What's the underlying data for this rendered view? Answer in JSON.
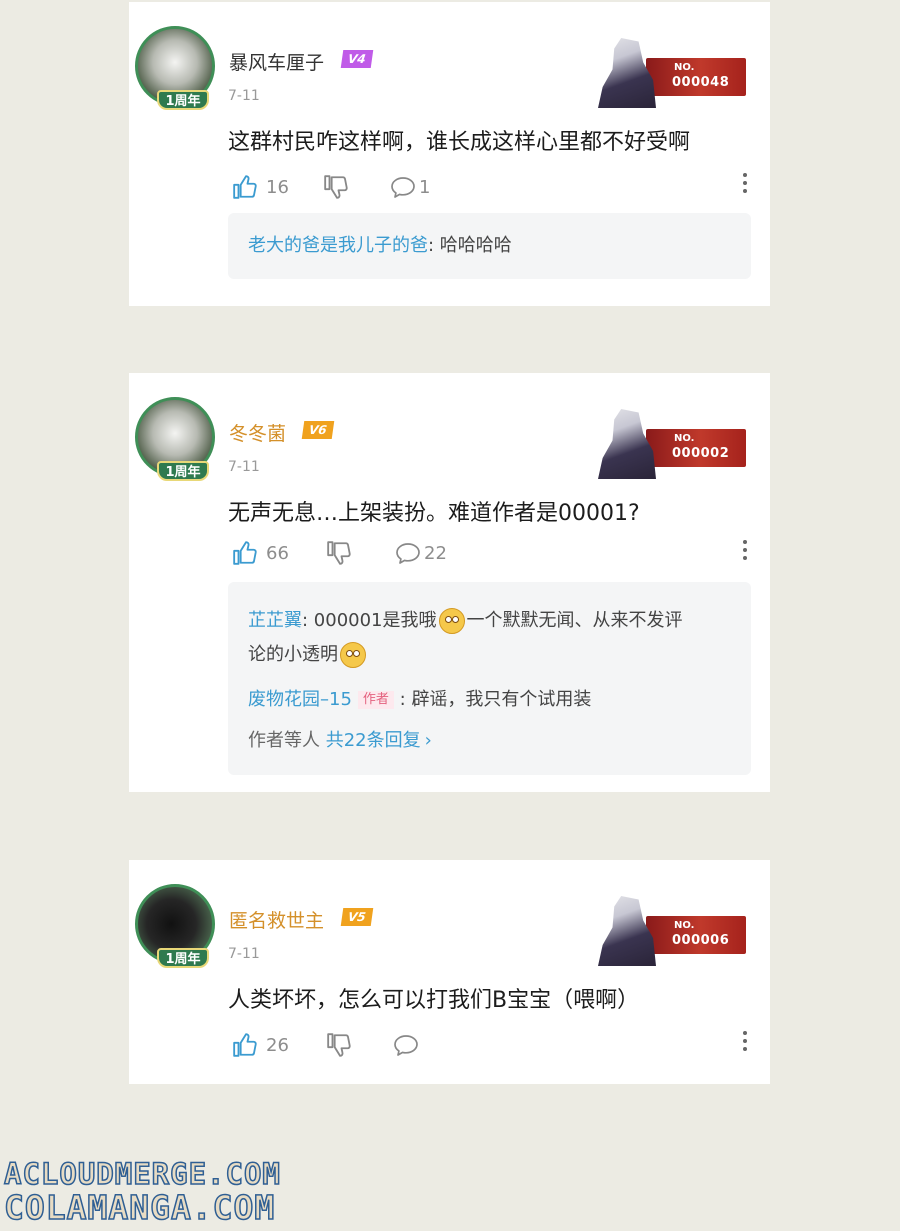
{
  "comments": [
    {
      "username": "暴风车厘子",
      "level": "V4",
      "avatar_badge": "1周年",
      "date": "7-11",
      "content": "这群村民咋这样啊，谁长成这样心里都不好受啊",
      "likes": "16",
      "comments_count": "1",
      "badge_label": "NO.",
      "badge_number": "000048",
      "replies": [
        {
          "user": "老大的爸是我儿子的爸",
          "sep": ": ",
          "text": "哈哈哈哈"
        }
      ]
    },
    {
      "username": "冬冬菌",
      "level": "V6",
      "avatar_badge": "1周年",
      "date": "7-11",
      "content": "无声无息…上架装扮。难道作者是00001?",
      "likes": "66",
      "comments_count": "22",
      "badge_label": "NO.",
      "badge_number": "000002",
      "replies": [
        {
          "user": "芷芷翼",
          "sep": ": ",
          "text_a": "000001是我哦",
          "text_b": "一个默默无闻、从来不发评",
          "text_c": "论的小透明"
        },
        {
          "user": "废物花园–15",
          "tag": "作者",
          "sep": " : ",
          "text": "辟谣，我只有个试用装"
        }
      ],
      "more_prefix": "作者等人 ",
      "more_link": "共22条回复",
      "more_arrow": "›"
    },
    {
      "username": "匿名救世主",
      "level": "V5",
      "avatar_badge": "1周年",
      "date": "7-11",
      "content": "人类坏坏，怎么可以打我们B宝宝（喂啊）",
      "likes": "26",
      "comments_count": "",
      "badge_label": "NO.",
      "badge_number": "000006"
    }
  ],
  "icons": {
    "like": "thumbs-up-icon",
    "dislike": "thumbs-down-icon",
    "comment": "speech-bubble-icon",
    "more": "more-vertical-icon"
  },
  "colors": {
    "like_blue": "#3b9bd0",
    "level_purple": "#c05be8",
    "level_orange": "#f0a21e",
    "gold_name": "#d4902a"
  },
  "watermark": {
    "line1": "ACLOUDMERGE.COM",
    "line2": "COLAMANGA.COM"
  }
}
